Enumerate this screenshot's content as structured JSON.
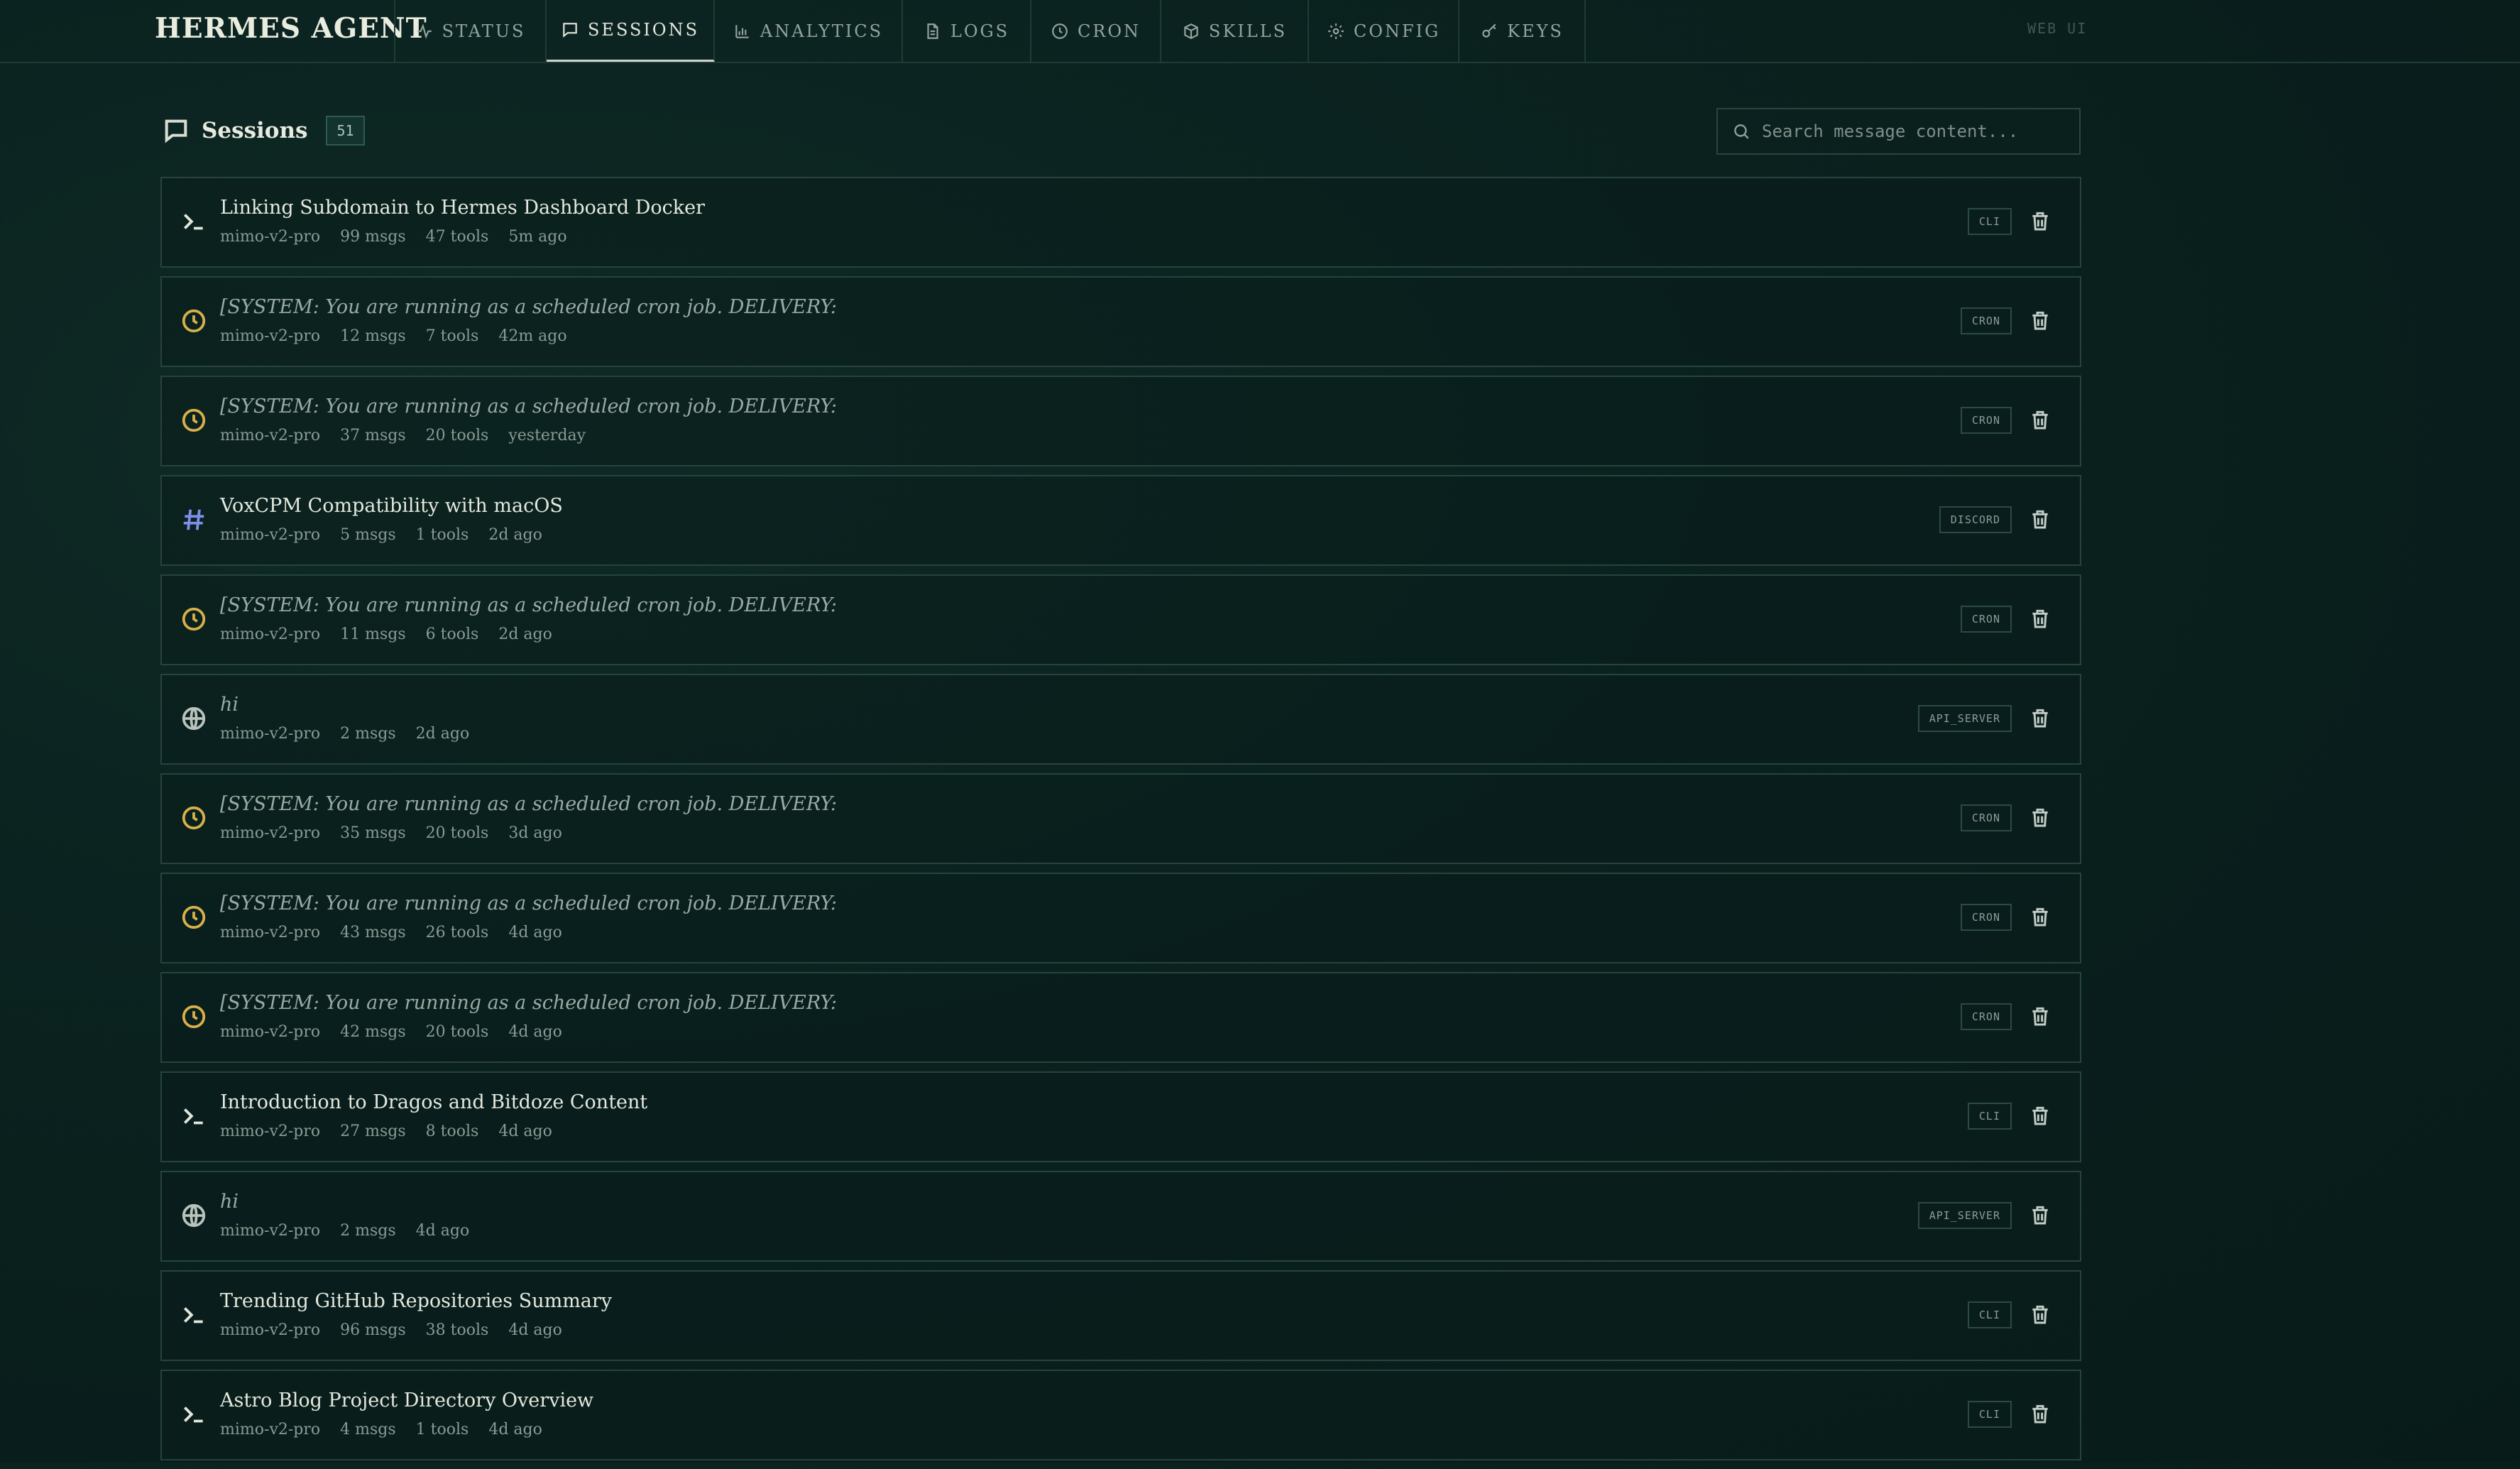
{
  "app": {
    "brand": "HERMES AGENT",
    "web_ui_tag": "WEB UI"
  },
  "nav": {
    "tabs": [
      {
        "label": "STATUS",
        "icon": "activity-icon",
        "active": false
      },
      {
        "label": "SESSIONS",
        "icon": "message-square-icon",
        "active": true
      },
      {
        "label": "ANALYTICS",
        "icon": "bar-chart-icon",
        "active": false
      },
      {
        "label": "LOGS",
        "icon": "file-text-icon",
        "active": false
      },
      {
        "label": "CRON",
        "icon": "clock-icon",
        "active": false
      },
      {
        "label": "SKILLS",
        "icon": "package-icon",
        "active": false
      },
      {
        "label": "CONFIG",
        "icon": "gear-icon",
        "active": false
      },
      {
        "label": "KEYS",
        "icon": "key-icon",
        "active": false
      }
    ]
  },
  "sessions": {
    "title": "Sessions",
    "count": "51",
    "search_placeholder": "Search message content...",
    "items": [
      {
        "title": "Linking Subdomain to Hermes Dashboard Docker",
        "italic": false,
        "source": "CLI",
        "icon": "terminal-icon",
        "model": "mimo-v2-pro",
        "msgs": "99 msgs",
        "tools": "47 tools",
        "time": "5m ago"
      },
      {
        "title": "[SYSTEM: You are running as a scheduled cron job. DELIVERY:",
        "italic": true,
        "source": "CRON",
        "icon": "clock-icon",
        "model": "mimo-v2-pro",
        "msgs": "12 msgs",
        "tools": "7 tools",
        "time": "42m ago"
      },
      {
        "title": "[SYSTEM: You are running as a scheduled cron job. DELIVERY:",
        "italic": true,
        "source": "CRON",
        "icon": "clock-icon",
        "model": "mimo-v2-pro",
        "msgs": "37 msgs",
        "tools": "20 tools",
        "time": "yesterday"
      },
      {
        "title": "VoxCPM Compatibility with macOS",
        "italic": false,
        "source": "DISCORD",
        "icon": "hash-icon",
        "model": "mimo-v2-pro",
        "msgs": "5 msgs",
        "tools": "1 tools",
        "time": "2d ago"
      },
      {
        "title": "[SYSTEM: You are running as a scheduled cron job. DELIVERY:",
        "italic": true,
        "source": "CRON",
        "icon": "clock-icon",
        "model": "mimo-v2-pro",
        "msgs": "11 msgs",
        "tools": "6 tools",
        "time": "2d ago"
      },
      {
        "title": "hi",
        "italic": true,
        "source": "API_SERVER",
        "icon": "globe-icon",
        "model": "mimo-v2-pro",
        "msgs": "2 msgs",
        "tools": "",
        "time": "2d ago"
      },
      {
        "title": "[SYSTEM: You are running as a scheduled cron job. DELIVERY:",
        "italic": true,
        "source": "CRON",
        "icon": "clock-icon",
        "model": "mimo-v2-pro",
        "msgs": "35 msgs",
        "tools": "20 tools",
        "time": "3d ago"
      },
      {
        "title": "[SYSTEM: You are running as a scheduled cron job. DELIVERY:",
        "italic": true,
        "source": "CRON",
        "icon": "clock-icon",
        "model": "mimo-v2-pro",
        "msgs": "43 msgs",
        "tools": "26 tools",
        "time": "4d ago"
      },
      {
        "title": "[SYSTEM: You are running as a scheduled cron job. DELIVERY:",
        "italic": true,
        "source": "CRON",
        "icon": "clock-icon",
        "model": "mimo-v2-pro",
        "msgs": "42 msgs",
        "tools": "20 tools",
        "time": "4d ago"
      },
      {
        "title": "Introduction to Dragos and Bitdoze Content",
        "italic": false,
        "source": "CLI",
        "icon": "terminal-icon",
        "model": "mimo-v2-pro",
        "msgs": "27 msgs",
        "tools": "8 tools",
        "time": "4d ago"
      },
      {
        "title": "hi",
        "italic": true,
        "source": "API_SERVER",
        "icon": "globe-icon",
        "model": "mimo-v2-pro",
        "msgs": "2 msgs",
        "tools": "",
        "time": "4d ago"
      },
      {
        "title": "Trending GitHub Repositories Summary",
        "italic": false,
        "source": "CLI",
        "icon": "terminal-icon",
        "model": "mimo-v2-pro",
        "msgs": "96 msgs",
        "tools": "38 tools",
        "time": "4d ago"
      },
      {
        "title": "Astro Blog Project Directory Overview",
        "italic": false,
        "source": "CLI",
        "icon": "terminal-icon",
        "model": "mimo-v2-pro",
        "msgs": "4 msgs",
        "tools": "1 tools",
        "time": "4d ago"
      }
    ]
  }
}
